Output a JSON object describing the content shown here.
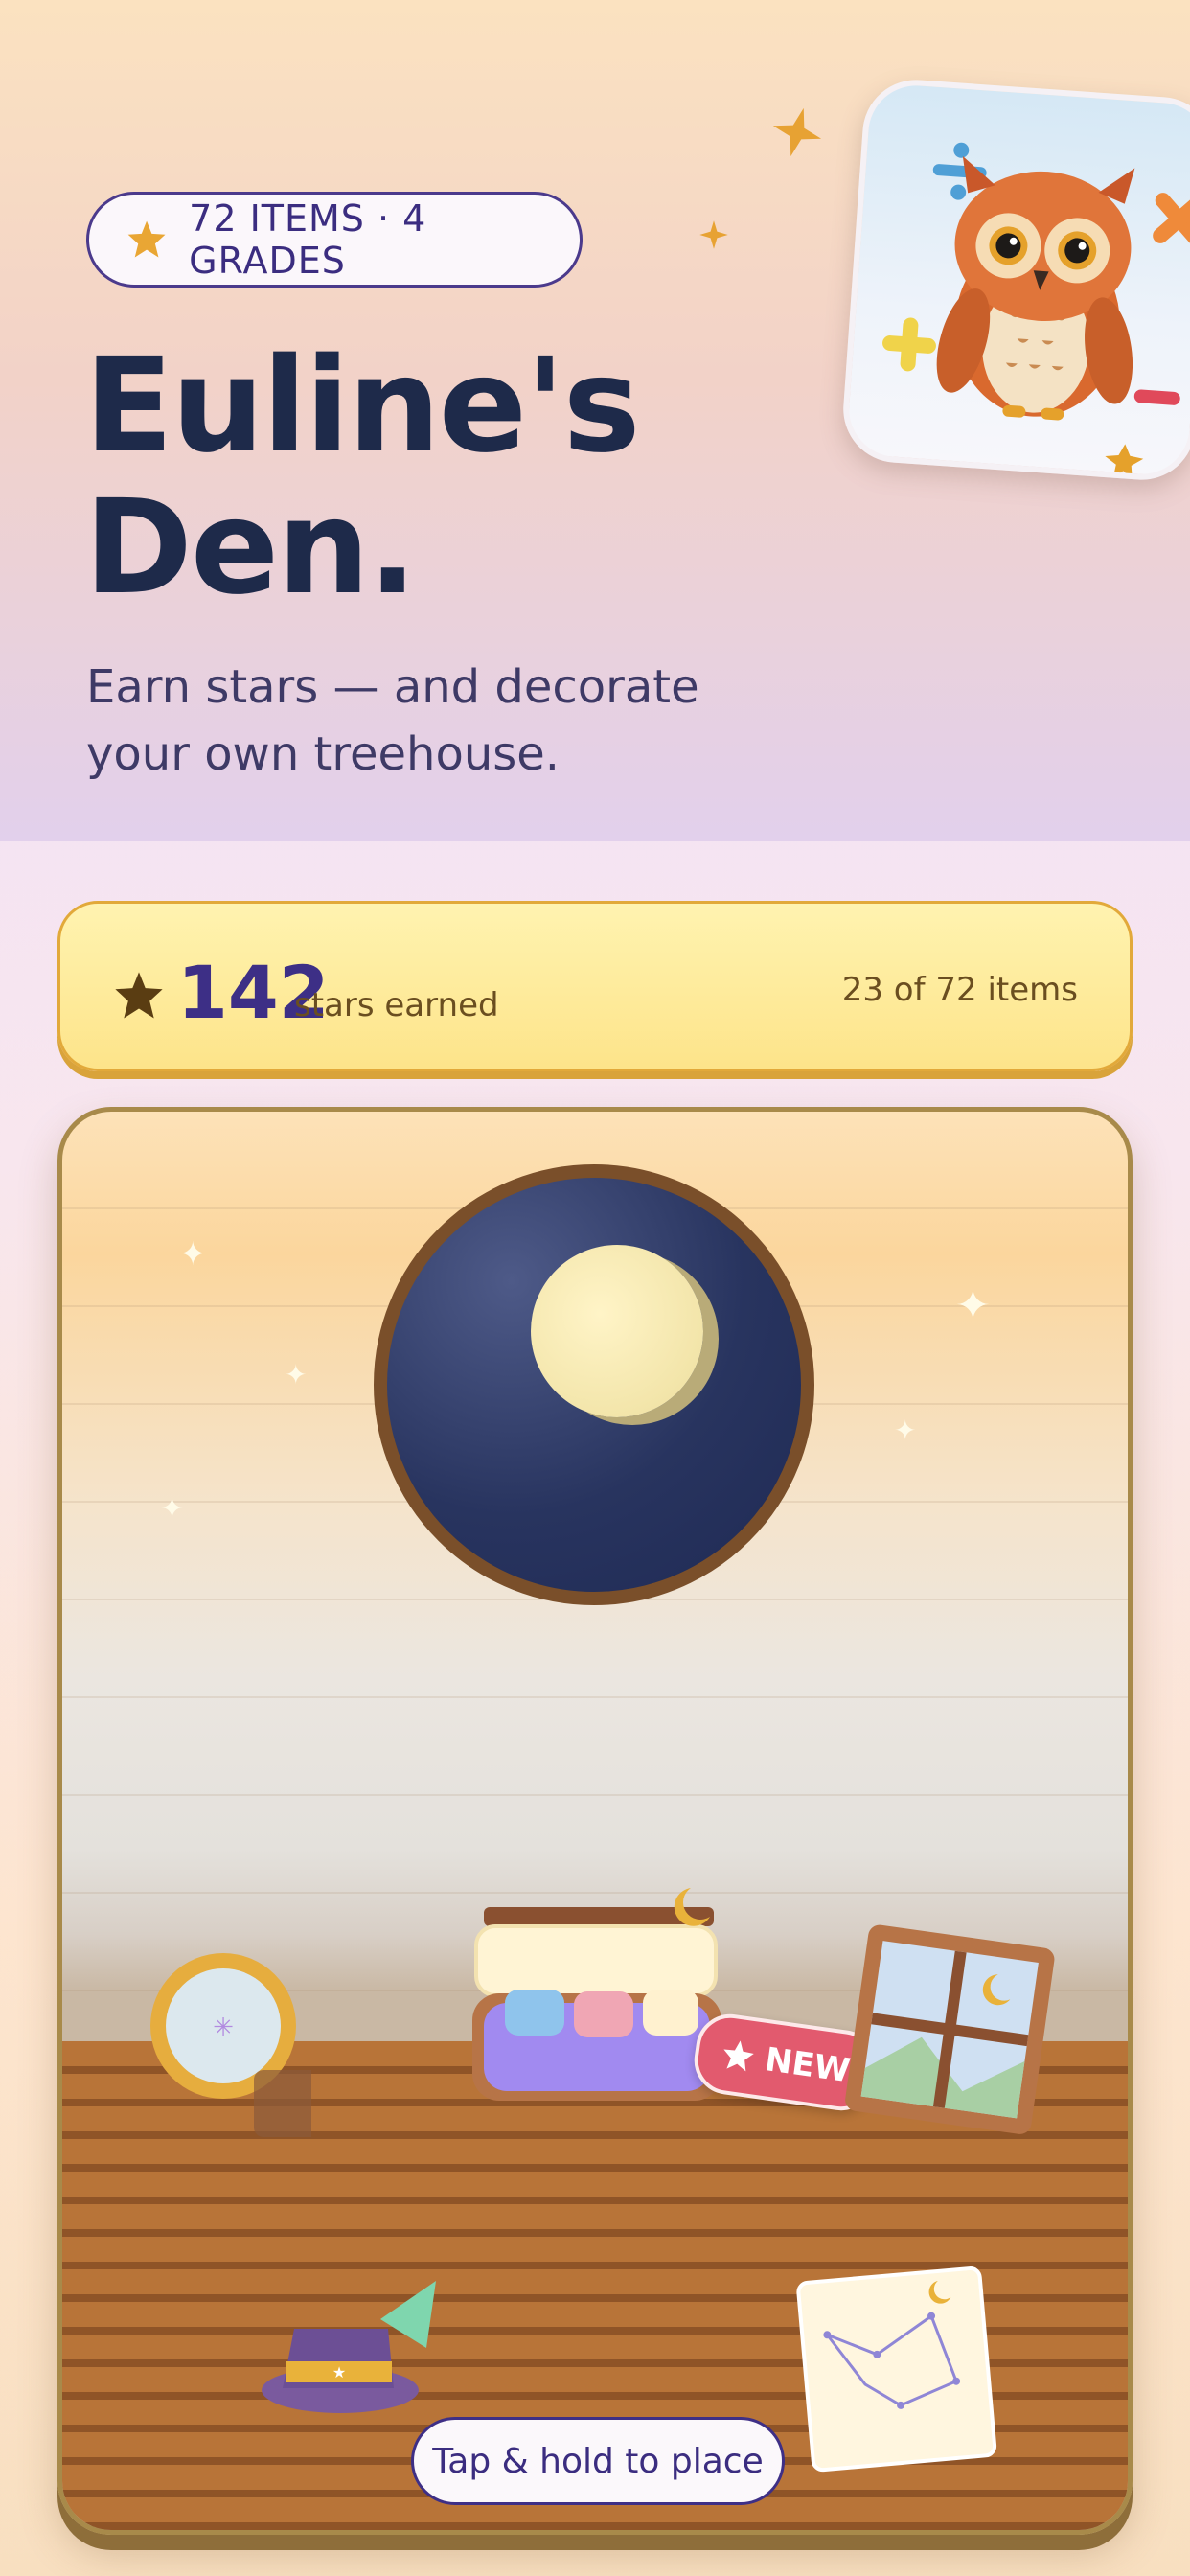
{
  "header": {
    "badge": "72 ITEMS · 4 GRADES",
    "title_line1": "Euline's",
    "title_line2": "Den.",
    "subtitle": "Earn stars — and decorate your own treehouse."
  },
  "stats": {
    "stars": "142",
    "stars_label": "stars earned",
    "items_progress": "23 of 72 items"
  },
  "room": {
    "new_tag": "NEW",
    "hint": "Tap & hold to place"
  },
  "icons": {
    "badge": "star-icon",
    "stats": "star-icon",
    "mascot": "owl-icon",
    "math": [
      "divide-icon",
      "times-icon",
      "plus-icon",
      "minus-icon"
    ]
  },
  "colors": {
    "ink": "#1e2a4a",
    "accent_purple": "#3d2f86",
    "star_gold": "#e5a12b",
    "stats_bg": "#fde48a",
    "new_tag": "#e25a6e",
    "floor": "#b87438"
  }
}
